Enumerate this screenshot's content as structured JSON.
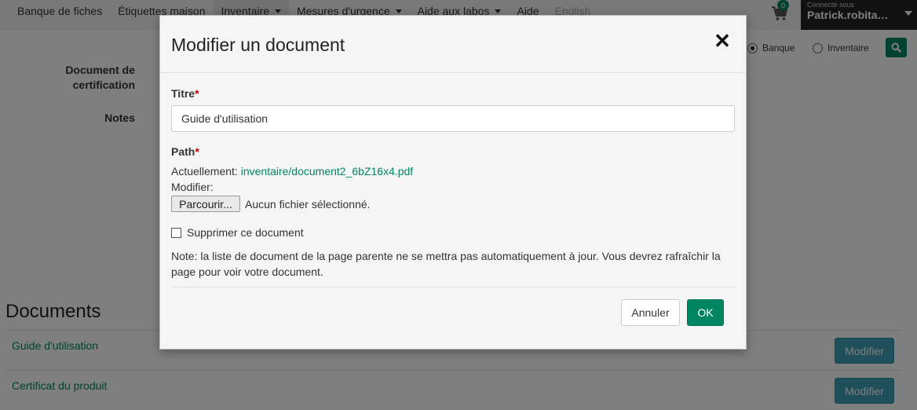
{
  "nav": {
    "items": [
      {
        "label": "Banque de fiches",
        "dropdown": false,
        "active": false
      },
      {
        "label": "Étiquettes maison",
        "dropdown": false,
        "active": false
      },
      {
        "label": "Inventaire",
        "dropdown": true,
        "active": true
      },
      {
        "label": "Mesures d'urgence",
        "dropdown": true,
        "active": false
      },
      {
        "label": "Aide aux labos",
        "dropdown": true,
        "active": false
      },
      {
        "label": "Aide",
        "dropdown": false,
        "active": false
      },
      {
        "label": "English",
        "dropdown": false,
        "active": false,
        "muted": true
      }
    ],
    "cart_count": "0",
    "connected_label": "Connecté sous",
    "username": "Patrick.robita…"
  },
  "search_scope": {
    "options": [
      {
        "label": "Banque",
        "checked": true
      },
      {
        "label": "Inventaire",
        "checked": false
      }
    ]
  },
  "background": {
    "label_certification_line1": "Document de",
    "label_certification_line2": "certification",
    "label_notes": "Notes",
    "documents_title": "Documents",
    "documents": [
      {
        "name": "Guide d'utilisation",
        "action": "Modifier"
      },
      {
        "name": "Certificat du produit",
        "action": "Modifier"
      }
    ]
  },
  "modal": {
    "title": "Modifier un document",
    "close_symbol": "✕",
    "title_label": "Titre",
    "required_mark": "*",
    "title_value": "Guide d'utilisation",
    "path_label": "Path",
    "current_label": "Actuellement:",
    "current_file": "inventaire/document2_6bZ16x4.pdf",
    "modify_label": "Modifier:",
    "browse_label": "Parcourir...",
    "no_file_label": "Aucun fichier sélectionné.",
    "delete_label": "Supprimer ce document",
    "note": "Note: la liste de document de la page parente ne se mettra pas automatiquement à jour. Vous devrez rafraîchir la page pour voir votre document.",
    "cancel_label": "Annuler",
    "ok_label": "OK"
  },
  "colors": {
    "accent": "#008563",
    "modify_button": "#3e9fb5",
    "user_box": "#222222"
  }
}
